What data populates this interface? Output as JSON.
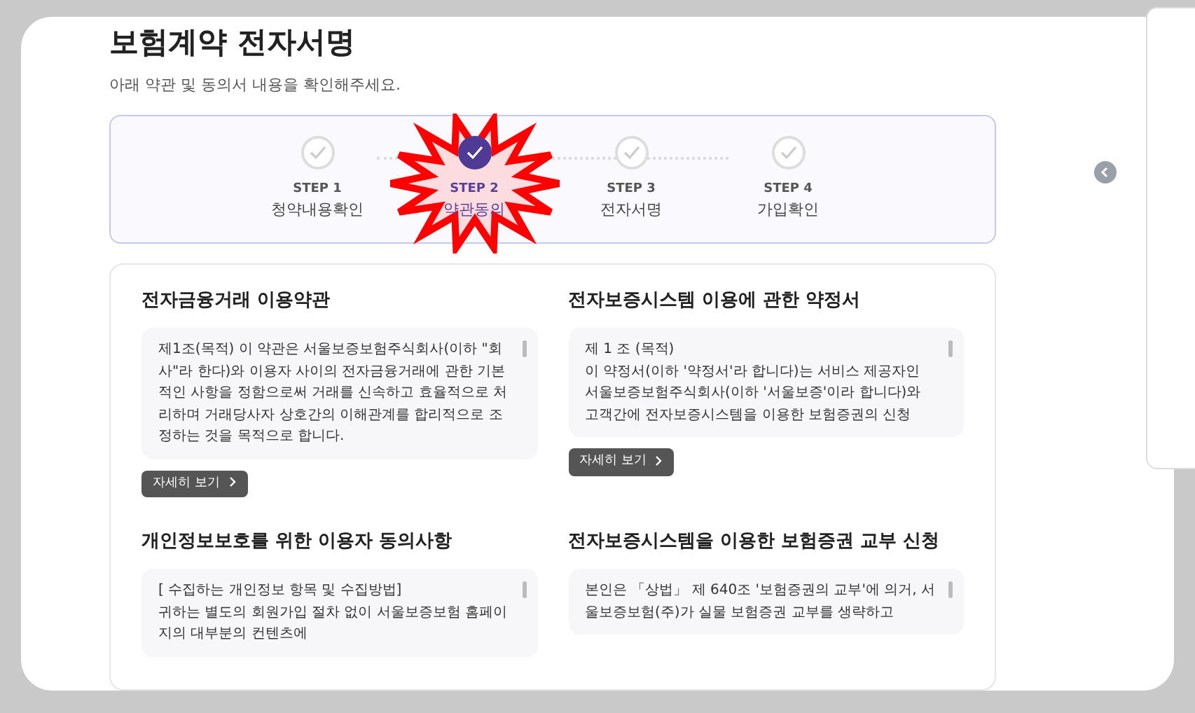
{
  "header": {
    "title": "보험계약 전자서명",
    "subtitle": "아래 약관 및 동의서 내용을 확인해주세요."
  },
  "steps": [
    {
      "step": "STEP 1",
      "name": "청약내용확인",
      "selected": false
    },
    {
      "step": "STEP 2",
      "name": "약관동의",
      "selected": true
    },
    {
      "step": "STEP 3",
      "name": "전자서명",
      "selected": false
    },
    {
      "step": "STEP 4",
      "name": "가입확인",
      "selected": false
    }
  ],
  "sections": [
    {
      "title": "전자금융거래 이용약관",
      "paragraphs": [
        "제1조(목적) 이 약관은 서울보증보험주식회사(이하 \"회사\"라 한다)와 이용자 사이의 전자금융거래에 관한 기본적인 사항을 정함으로써 거래를 신속하고 효율적으로 처리하며 거래당사자 상호간의 이해관계를 합리적으로 조정하는 것을 목적으로 합니다."
      ],
      "button": "자세히 보기"
    },
    {
      "title": "전자보증시스템 이용에 관한 약정서",
      "paragraphs": [
        "제 1 조 (목적)",
        "이 약정서(이하 '약정서'라 합니다)는 서비스 제공자인 서울보증보험주식회사(이하 '서울보증'이라 합니다)와 고객간에 전자보증시스템을 이용한 보험증권의 신청"
      ],
      "button": "자세히 보기"
    },
    {
      "title": "개인정보보호를 위한 이용자 동의사항",
      "paragraphs": [
        "[ 수집하는 개인정보 항목 및 수집방법]",
        "귀하는 별도의 회원가입 절차 없이 서울보증보험 홈페이지의 대부분의 컨텐츠에"
      ]
    },
    {
      "title": "전자보증시스템을 이용한 보험증권 교부 신청",
      "paragraphs": [
        "본인은 「상법」 제 640조 '보험증권의 교부'에 의거, 서울보증보험(주)가 실물 보험증권 교부를 생략하고"
      ]
    }
  ]
}
